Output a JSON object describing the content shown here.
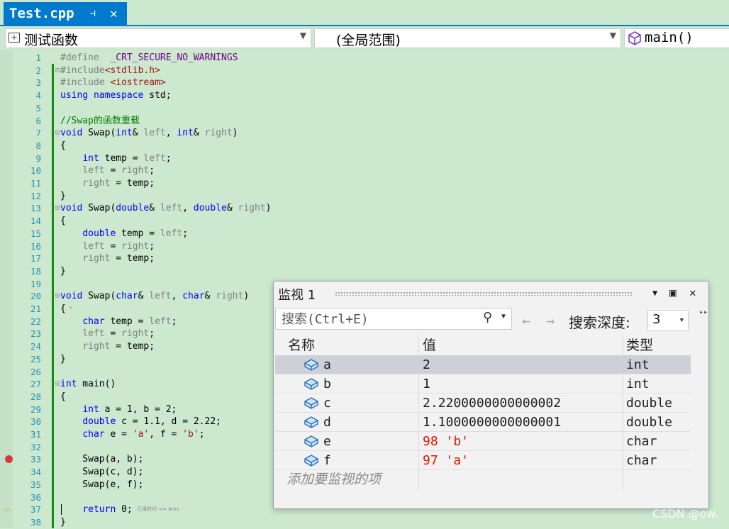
{
  "tab": {
    "title": "Test.cpp",
    "pin_glyph": "⊣",
    "close_glyph": "✕"
  },
  "navbar": {
    "project": "测试函数",
    "scope": "(全局范围)",
    "member": "main()"
  },
  "editor": {
    "lines": [
      {
        "n": "1",
        "tokens": [
          [
            "pp",
            "#define  "
          ],
          [
            "mac",
            "_CRT_SECURE_NO_WARNINGS"
          ]
        ]
      },
      {
        "n": "2",
        "fold": "⊟",
        "tokens": [
          [
            "pp",
            "#include"
          ],
          [
            "str",
            "<stdlib.h>"
          ]
        ]
      },
      {
        "n": "3",
        "tokens": [
          [
            "pp",
            "#include "
          ],
          [
            "str",
            "<iostream>"
          ]
        ]
      },
      {
        "n": "4",
        "tokens": [
          [
            "kw",
            "using"
          ],
          [
            "",
            ""
          ],
          [
            "kw",
            " namespace"
          ],
          [
            "",
            " std;"
          ]
        ]
      },
      {
        "n": "5",
        "tokens": []
      },
      {
        "n": "6",
        "tokens": [
          [
            "cmt",
            "//Swap的函数重载"
          ]
        ]
      },
      {
        "n": "7",
        "fold": "⊟",
        "tokens": [
          [
            "kw",
            "void"
          ],
          [
            "",
            " Swap("
          ],
          [
            "kw",
            "int"
          ],
          [
            "",
            "& "
          ],
          [
            "par",
            "left"
          ],
          [
            "",
            ", "
          ],
          [
            "kw",
            "int"
          ],
          [
            "",
            "& "
          ],
          [
            "par",
            "right"
          ],
          [
            "",
            ")"
          ]
        ]
      },
      {
        "n": "8",
        "tokens": [
          [
            "",
            "{"
          ]
        ]
      },
      {
        "n": "9",
        "tokens": [
          [
            "",
            "    "
          ],
          [
            "kw",
            "int"
          ],
          [
            "",
            " temp = "
          ],
          [
            "par",
            "left"
          ],
          [
            "",
            ";"
          ]
        ]
      },
      {
        "n": "10",
        "tokens": [
          [
            "",
            "    "
          ],
          [
            "par",
            "left"
          ],
          [
            "",
            " = "
          ],
          [
            "par",
            "right"
          ],
          [
            "",
            ";"
          ]
        ]
      },
      {
        "n": "11",
        "tokens": [
          [
            "",
            "    "
          ],
          [
            "par",
            "right"
          ],
          [
            "",
            " = temp;"
          ]
        ]
      },
      {
        "n": "12",
        "tokens": [
          [
            "",
            "}"
          ]
        ]
      },
      {
        "n": "13",
        "fold": "⊟",
        "tokens": [
          [
            "kw",
            "void"
          ],
          [
            "",
            " Swap("
          ],
          [
            "kw",
            "double"
          ],
          [
            "",
            "& "
          ],
          [
            "par",
            "left"
          ],
          [
            "",
            ", "
          ],
          [
            "kw",
            "double"
          ],
          [
            "",
            "& "
          ],
          [
            "par",
            "right"
          ],
          [
            "",
            ")"
          ]
        ]
      },
      {
        "n": "14",
        "tokens": [
          [
            "",
            "{"
          ]
        ]
      },
      {
        "n": "15",
        "tokens": [
          [
            "",
            "    "
          ],
          [
            "kw",
            "double"
          ],
          [
            "",
            " temp = "
          ],
          [
            "par",
            "left"
          ],
          [
            "",
            ";"
          ]
        ]
      },
      {
        "n": "16",
        "tokens": [
          [
            "",
            "    "
          ],
          [
            "par",
            "left"
          ],
          [
            "",
            " = "
          ],
          [
            "par",
            "right"
          ],
          [
            "",
            ";"
          ]
        ]
      },
      {
        "n": "17",
        "tokens": [
          [
            "",
            "    "
          ],
          [
            "par",
            "right"
          ],
          [
            "",
            " = temp;"
          ]
        ]
      },
      {
        "n": "18",
        "tokens": [
          [
            "",
            "}"
          ]
        ]
      },
      {
        "n": "19",
        "tokens": []
      },
      {
        "n": "20",
        "fold": "⊟",
        "tokens": [
          [
            "kw",
            "void"
          ],
          [
            "",
            " Swap("
          ],
          [
            "kw",
            "char"
          ],
          [
            "",
            "& "
          ],
          [
            "par",
            "left"
          ],
          [
            "",
            ", "
          ],
          [
            "kw",
            "char"
          ],
          [
            "",
            "& "
          ],
          [
            "par",
            "right"
          ],
          [
            "",
            ")"
          ]
        ]
      },
      {
        "n": "21",
        "tokens": [
          [
            "",
            "{"
          ]
        ]
      },
      {
        "n": "22",
        "tokens": [
          [
            "",
            "    "
          ],
          [
            "kw",
            "char"
          ],
          [
            "",
            " temp = "
          ],
          [
            "par",
            "left"
          ],
          [
            "",
            ";"
          ]
        ]
      },
      {
        "n": "23",
        "tokens": [
          [
            "",
            "    "
          ],
          [
            "par",
            "left"
          ],
          [
            "",
            " = "
          ],
          [
            "par",
            "right"
          ],
          [
            "",
            ";"
          ]
        ]
      },
      {
        "n": "24",
        "tokens": [
          [
            "",
            "    "
          ],
          [
            "par",
            "right"
          ],
          [
            "",
            " = temp;"
          ]
        ]
      },
      {
        "n": "25",
        "tokens": [
          [
            "",
            "}"
          ]
        ]
      },
      {
        "n": "26",
        "tokens": []
      },
      {
        "n": "27",
        "fold": "⊟",
        "tokens": [
          [
            "kw",
            "int"
          ],
          [
            "",
            " main()"
          ]
        ]
      },
      {
        "n": "28",
        "tokens": [
          [
            "",
            "{"
          ]
        ]
      },
      {
        "n": "29",
        "tokens": [
          [
            "",
            "    "
          ],
          [
            "kw",
            "int"
          ],
          [
            "",
            " a = 1, b = 2;"
          ]
        ]
      },
      {
        "n": "30",
        "tokens": [
          [
            "",
            "    "
          ],
          [
            "kw",
            "double"
          ],
          [
            "",
            " c = 1.1, d = 2.22;"
          ]
        ]
      },
      {
        "n": "31",
        "tokens": [
          [
            "",
            "    "
          ],
          [
            "kw",
            "char"
          ],
          [
            "",
            " e = "
          ],
          [
            "str",
            "'a'"
          ],
          [
            "",
            ", f = "
          ],
          [
            "str",
            "'b'"
          ],
          [
            "",
            ";"
          ]
        ]
      },
      {
        "n": "32",
        "tokens": []
      },
      {
        "n": "33",
        "tokens": [
          [
            "",
            "    Swap(a, b);"
          ]
        ]
      },
      {
        "n": "34",
        "tokens": [
          [
            "",
            "    Swap(c, d);"
          ]
        ]
      },
      {
        "n": "35",
        "tokens": [
          [
            "",
            "    Swap(e, f);"
          ]
        ]
      },
      {
        "n": "36",
        "tokens": []
      },
      {
        "n": "37",
        "tokens": [
          [
            "",
            "    "
          ],
          [
            "kw",
            "return"
          ],
          [
            "",
            " 0;"
          ]
        ]
      },
      {
        "n": "38",
        "tokens": [
          [
            "",
            "}"
          ]
        ]
      }
    ],
    "hint_text": "已用时间 <= 4ms",
    "breakpoint_line": "33",
    "current_line": "37"
  },
  "watch": {
    "title": "监视 1",
    "search_placeholder": "搜索(Ctrl+E)",
    "depth_label": "搜索深度:",
    "depth_value": "3",
    "columns": {
      "name": "名称",
      "value": "值",
      "type": "类型"
    },
    "rows": [
      {
        "name": "a",
        "value": "2",
        "type": "int",
        "changed": false,
        "selected": true
      },
      {
        "name": "b",
        "value": "1",
        "type": "int",
        "changed": false,
        "selected": false
      },
      {
        "name": "c",
        "value": "2.2200000000000002",
        "type": "double",
        "changed": false,
        "selected": false
      },
      {
        "name": "d",
        "value": "1.1000000000000001",
        "type": "double",
        "changed": false,
        "selected": false
      },
      {
        "name": "e",
        "value": "98 'b'",
        "type": "char",
        "changed": true,
        "selected": false
      },
      {
        "name": "f",
        "value": "97 'a'",
        "type": "char",
        "changed": true,
        "selected": false
      }
    ],
    "add_item_placeholder": "添加要监视的项"
  },
  "watermark": "CSDN @ow.",
  "colors": {
    "accent": "#007acc",
    "background": "#cce8cf",
    "changed_value": "#e51400"
  }
}
